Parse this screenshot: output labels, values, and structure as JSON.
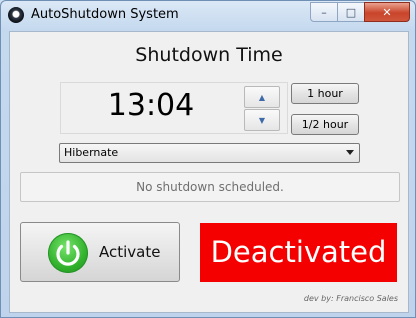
{
  "window": {
    "title": "AutoShutdown System",
    "caption": {
      "minimize": "–",
      "maximize": "□",
      "close": "✕"
    }
  },
  "heading": "Shutdown Time",
  "time": {
    "value": "13:04",
    "up": "▲",
    "down": "▼"
  },
  "quick": {
    "one_hour": "1 hour",
    "half_hour": "1/2 hour"
  },
  "mode": {
    "selected": "Hibernate"
  },
  "status": "No shutdown scheduled.",
  "activate_label": "Activate",
  "state_label": "Deactivated",
  "credit": "dev by: Francisco Sales",
  "colors": {
    "state_bg": "#f50000",
    "power_icon": "#31b12c"
  }
}
